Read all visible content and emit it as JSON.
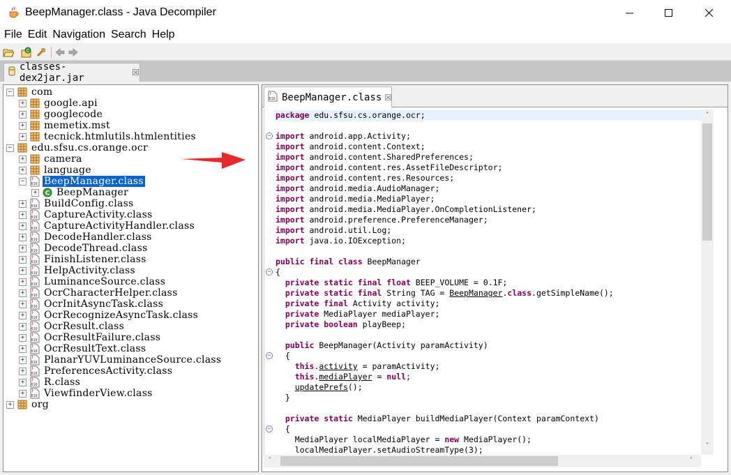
{
  "window": {
    "title": "BeepManager.class - Java Decompiler"
  },
  "menu": [
    "File",
    "Edit",
    "Navigation",
    "Search",
    "Help"
  ],
  "toolbar": {
    "icons": [
      "open-file-icon",
      "open-type-icon",
      "search-icon",
      "back-icon",
      "forward-icon"
    ]
  },
  "tabs": {
    "jar_tab": "classes-dex2jar.jar",
    "class_tab": "BeepManager.class",
    "close_glyph": "☒"
  },
  "tree": {
    "nodes": [
      {
        "label": "com",
        "toggle": "−",
        "icon": "package"
      },
      {
        "label": "google.api",
        "toggle": "+",
        "icon": "package"
      },
      {
        "label": "googlecode",
        "toggle": "+",
        "icon": "package"
      },
      {
        "label": "memetix.mst",
        "toggle": "+",
        "icon": "package"
      },
      {
        "label": "tecnick.htmlutils.htmlentities",
        "toggle": "+",
        "icon": "package"
      },
      {
        "label": "edu.sfsu.cs.orange.ocr",
        "toggle": "−",
        "icon": "package"
      },
      {
        "label": "camera",
        "toggle": "+",
        "icon": "package"
      },
      {
        "label": "language",
        "toggle": "+",
        "icon": "package"
      },
      {
        "label": "BeepManager.class",
        "toggle": "−",
        "icon": "classfile",
        "selected": true
      },
      {
        "label": "BeepManager",
        "toggle": "+",
        "icon": "class"
      },
      {
        "label": "BuildConfig.class",
        "toggle": "+",
        "icon": "classfile"
      },
      {
        "label": "CaptureActivity.class",
        "toggle": "+",
        "icon": "classfile"
      },
      {
        "label": "CaptureActivityHandler.class",
        "toggle": "+",
        "icon": "classfile"
      },
      {
        "label": "DecodeHandler.class",
        "toggle": "+",
        "icon": "classfile"
      },
      {
        "label": "DecodeThread.class",
        "toggle": "+",
        "icon": "classfile"
      },
      {
        "label": "FinishListener.class",
        "toggle": "+",
        "icon": "classfile"
      },
      {
        "label": "HelpActivity.class",
        "toggle": "+",
        "icon": "classfile"
      },
      {
        "label": "LuminanceSource.class",
        "toggle": "+",
        "icon": "classfile"
      },
      {
        "label": "OcrCharacterHelper.class",
        "toggle": "+",
        "icon": "classfile"
      },
      {
        "label": "OcrInitAsyncTask.class",
        "toggle": "+",
        "icon": "classfile"
      },
      {
        "label": "OcrRecognizeAsyncTask.class",
        "toggle": "+",
        "icon": "classfile"
      },
      {
        "label": "OcrResult.class",
        "toggle": "+",
        "icon": "classfile"
      },
      {
        "label": "OcrResultFailure.class",
        "toggle": "+",
        "icon": "classfile"
      },
      {
        "label": "OcrResultText.class",
        "toggle": "+",
        "icon": "classfile"
      },
      {
        "label": "PlanarYUVLuminanceSource.class",
        "toggle": "+",
        "icon": "classfile"
      },
      {
        "label": "PreferencesActivity.class",
        "toggle": "+",
        "icon": "classfile"
      },
      {
        "label": "R.class",
        "toggle": "+",
        "icon": "classfile"
      },
      {
        "label": "ViewfinderView.class",
        "toggle": "+",
        "icon": "classfile"
      },
      {
        "label": "org",
        "toggle": "+",
        "icon": "package"
      }
    ]
  },
  "code": {
    "lines": [
      [
        {
          "t": "package",
          "k": 1
        },
        {
          "t": " edu.sfsu.cs.orange.ocr;"
        }
      ],
      [],
      [
        {
          "t": "import",
          "k": 1
        },
        {
          "t": " android.app.Activity;"
        }
      ],
      [
        {
          "t": "import",
          "k": 1
        },
        {
          "t": " android.content.Context;"
        }
      ],
      [
        {
          "t": "import",
          "k": 1
        },
        {
          "t": " android.content.SharedPreferences;"
        }
      ],
      [
        {
          "t": "import",
          "k": 1
        },
        {
          "t": " android.content.res.AssetFileDescriptor;"
        }
      ],
      [
        {
          "t": "import",
          "k": 1
        },
        {
          "t": " android.content.res.Resources;"
        }
      ],
      [
        {
          "t": "import",
          "k": 1
        },
        {
          "t": " android.media.AudioManager;"
        }
      ],
      [
        {
          "t": "import",
          "k": 1
        },
        {
          "t": " android.media.MediaPlayer;"
        }
      ],
      [
        {
          "t": "import",
          "k": 1
        },
        {
          "t": " android.media.MediaPlayer.OnCompletionListener;"
        }
      ],
      [
        {
          "t": "import",
          "k": 1
        },
        {
          "t": " android.preference.PreferenceManager;"
        }
      ],
      [
        {
          "t": "import",
          "k": 1
        },
        {
          "t": " android.util.Log;"
        }
      ],
      [
        {
          "t": "import",
          "k": 1
        },
        {
          "t": " java.io.IOException;"
        }
      ],
      [],
      [
        {
          "t": "public final class",
          "k": 1
        },
        {
          "t": " BeepManager"
        }
      ],
      [
        {
          "t": "{"
        }
      ],
      [
        {
          "t": "  "
        },
        {
          "t": "private static final float",
          "k": 1
        },
        {
          "t": " BEEP_VOLUME = 0.1F;"
        }
      ],
      [
        {
          "t": "  "
        },
        {
          "t": "private static final",
          "k": 1
        },
        {
          "t": " String TAG = "
        },
        {
          "t": "BeepManager",
          "u": 1
        },
        {
          "t": "."
        },
        {
          "t": "class",
          "k": 1
        },
        {
          "t": ".getSimpleName();"
        }
      ],
      [
        {
          "t": "  "
        },
        {
          "t": "private final",
          "k": 1
        },
        {
          "t": " Activity activity;"
        }
      ],
      [
        {
          "t": "  "
        },
        {
          "t": "private",
          "k": 1
        },
        {
          "t": " MediaPlayer mediaPlayer;"
        }
      ],
      [
        {
          "t": "  "
        },
        {
          "t": "private boolean",
          "k": 1
        },
        {
          "t": " playBeep;"
        }
      ],
      [],
      [
        {
          "t": "  "
        },
        {
          "t": "public",
          "k": 1
        },
        {
          "t": " BeepManager(Activity paramActivity)"
        }
      ],
      [
        {
          "t": "  {"
        }
      ],
      [
        {
          "t": "    "
        },
        {
          "t": "this",
          "k": 1
        },
        {
          "t": "."
        },
        {
          "t": "activity",
          "u": 1
        },
        {
          "t": " = paramActivity;"
        }
      ],
      [
        {
          "t": "    "
        },
        {
          "t": "this",
          "k": 1
        },
        {
          "t": "."
        },
        {
          "t": "mediaPlayer",
          "u": 1
        },
        {
          "t": " = "
        },
        {
          "t": "null",
          "k": 1
        },
        {
          "t": ";"
        }
      ],
      [
        {
          "t": "    "
        },
        {
          "t": "updatePrefs",
          "u": 1
        },
        {
          "t": "();"
        }
      ],
      [
        {
          "t": "  }"
        }
      ],
      [],
      [
        {
          "t": "  "
        },
        {
          "t": "private static",
          "k": 1
        },
        {
          "t": " MediaPlayer buildMediaPlayer(Context paramContext)"
        }
      ],
      [
        {
          "t": "  {"
        }
      ],
      [
        {
          "t": "    MediaPlayer localMediaPlayer = "
        },
        {
          "t": "new",
          "k": 1
        },
        {
          "t": " MediaPlayer();"
        }
      ],
      [
        {
          "t": "    localMediaPlayer.setAudioStreamType(3);"
        }
      ]
    ],
    "fold_markers": [
      2,
      15,
      23,
      30
    ]
  }
}
